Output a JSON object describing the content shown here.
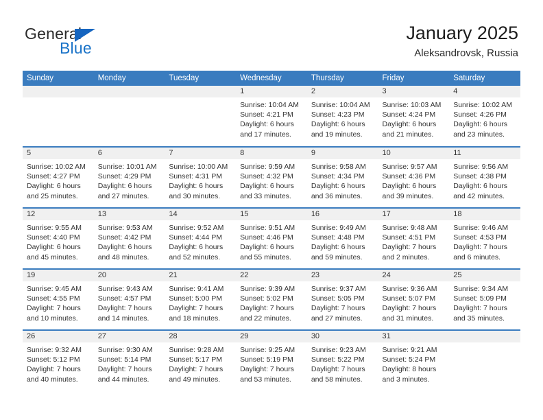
{
  "brand": {
    "name_top": "General",
    "name_bottom": "Blue",
    "triangle_color": "#1565c0",
    "blue_color": "#1a73c8"
  },
  "header": {
    "title": "January 2025",
    "location": "Aleksandrovsk, Russia"
  },
  "theme": {
    "header_blue": "#3a7cbf",
    "daynum_bg": "#f0f0f0",
    "text": "#333333"
  },
  "calendar": {
    "weekday_headers": [
      "Sunday",
      "Monday",
      "Tuesday",
      "Wednesday",
      "Thursday",
      "Friday",
      "Saturday"
    ],
    "weeks": [
      [
        {
          "day": "",
          "empty": true
        },
        {
          "day": "",
          "empty": true
        },
        {
          "day": "",
          "empty": true
        },
        {
          "day": "1",
          "sunrise": "Sunrise: 10:04 AM",
          "sunset": "Sunset: 4:21 PM",
          "daylight1": "Daylight: 6 hours",
          "daylight2": "and 17 minutes."
        },
        {
          "day": "2",
          "sunrise": "Sunrise: 10:04 AM",
          "sunset": "Sunset: 4:23 PM",
          "daylight1": "Daylight: 6 hours",
          "daylight2": "and 19 minutes."
        },
        {
          "day": "3",
          "sunrise": "Sunrise: 10:03 AM",
          "sunset": "Sunset: 4:24 PM",
          "daylight1": "Daylight: 6 hours",
          "daylight2": "and 21 minutes."
        },
        {
          "day": "4",
          "sunrise": "Sunrise: 10:02 AM",
          "sunset": "Sunset: 4:26 PM",
          "daylight1": "Daylight: 6 hours",
          "daylight2": "and 23 minutes."
        }
      ],
      [
        {
          "day": "5",
          "sunrise": "Sunrise: 10:02 AM",
          "sunset": "Sunset: 4:27 PM",
          "daylight1": "Daylight: 6 hours",
          "daylight2": "and 25 minutes."
        },
        {
          "day": "6",
          "sunrise": "Sunrise: 10:01 AM",
          "sunset": "Sunset: 4:29 PM",
          "daylight1": "Daylight: 6 hours",
          "daylight2": "and 27 minutes."
        },
        {
          "day": "7",
          "sunrise": "Sunrise: 10:00 AM",
          "sunset": "Sunset: 4:31 PM",
          "daylight1": "Daylight: 6 hours",
          "daylight2": "and 30 minutes."
        },
        {
          "day": "8",
          "sunrise": "Sunrise: 9:59 AM",
          "sunset": "Sunset: 4:32 PM",
          "daylight1": "Daylight: 6 hours",
          "daylight2": "and 33 minutes."
        },
        {
          "day": "9",
          "sunrise": "Sunrise: 9:58 AM",
          "sunset": "Sunset: 4:34 PM",
          "daylight1": "Daylight: 6 hours",
          "daylight2": "and 36 minutes."
        },
        {
          "day": "10",
          "sunrise": "Sunrise: 9:57 AM",
          "sunset": "Sunset: 4:36 PM",
          "daylight1": "Daylight: 6 hours",
          "daylight2": "and 39 minutes."
        },
        {
          "day": "11",
          "sunrise": "Sunrise: 9:56 AM",
          "sunset": "Sunset: 4:38 PM",
          "daylight1": "Daylight: 6 hours",
          "daylight2": "and 42 minutes."
        }
      ],
      [
        {
          "day": "12",
          "sunrise": "Sunrise: 9:55 AM",
          "sunset": "Sunset: 4:40 PM",
          "daylight1": "Daylight: 6 hours",
          "daylight2": "and 45 minutes."
        },
        {
          "day": "13",
          "sunrise": "Sunrise: 9:53 AM",
          "sunset": "Sunset: 4:42 PM",
          "daylight1": "Daylight: 6 hours",
          "daylight2": "and 48 minutes."
        },
        {
          "day": "14",
          "sunrise": "Sunrise: 9:52 AM",
          "sunset": "Sunset: 4:44 PM",
          "daylight1": "Daylight: 6 hours",
          "daylight2": "and 52 minutes."
        },
        {
          "day": "15",
          "sunrise": "Sunrise: 9:51 AM",
          "sunset": "Sunset: 4:46 PM",
          "daylight1": "Daylight: 6 hours",
          "daylight2": "and 55 minutes."
        },
        {
          "day": "16",
          "sunrise": "Sunrise: 9:49 AM",
          "sunset": "Sunset: 4:48 PM",
          "daylight1": "Daylight: 6 hours",
          "daylight2": "and 59 minutes."
        },
        {
          "day": "17",
          "sunrise": "Sunrise: 9:48 AM",
          "sunset": "Sunset: 4:51 PM",
          "daylight1": "Daylight: 7 hours",
          "daylight2": "and 2 minutes."
        },
        {
          "day": "18",
          "sunrise": "Sunrise: 9:46 AM",
          "sunset": "Sunset: 4:53 PM",
          "daylight1": "Daylight: 7 hours",
          "daylight2": "and 6 minutes."
        }
      ],
      [
        {
          "day": "19",
          "sunrise": "Sunrise: 9:45 AM",
          "sunset": "Sunset: 4:55 PM",
          "daylight1": "Daylight: 7 hours",
          "daylight2": "and 10 minutes."
        },
        {
          "day": "20",
          "sunrise": "Sunrise: 9:43 AM",
          "sunset": "Sunset: 4:57 PM",
          "daylight1": "Daylight: 7 hours",
          "daylight2": "and 14 minutes."
        },
        {
          "day": "21",
          "sunrise": "Sunrise: 9:41 AM",
          "sunset": "Sunset: 5:00 PM",
          "daylight1": "Daylight: 7 hours",
          "daylight2": "and 18 minutes."
        },
        {
          "day": "22",
          "sunrise": "Sunrise: 9:39 AM",
          "sunset": "Sunset: 5:02 PM",
          "daylight1": "Daylight: 7 hours",
          "daylight2": "and 22 minutes."
        },
        {
          "day": "23",
          "sunrise": "Sunrise: 9:37 AM",
          "sunset": "Sunset: 5:05 PM",
          "daylight1": "Daylight: 7 hours",
          "daylight2": "and 27 minutes."
        },
        {
          "day": "24",
          "sunrise": "Sunrise: 9:36 AM",
          "sunset": "Sunset: 5:07 PM",
          "daylight1": "Daylight: 7 hours",
          "daylight2": "and 31 minutes."
        },
        {
          "day": "25",
          "sunrise": "Sunrise: 9:34 AM",
          "sunset": "Sunset: 5:09 PM",
          "daylight1": "Daylight: 7 hours",
          "daylight2": "and 35 minutes."
        }
      ],
      [
        {
          "day": "26",
          "sunrise": "Sunrise: 9:32 AM",
          "sunset": "Sunset: 5:12 PM",
          "daylight1": "Daylight: 7 hours",
          "daylight2": "and 40 minutes."
        },
        {
          "day": "27",
          "sunrise": "Sunrise: 9:30 AM",
          "sunset": "Sunset: 5:14 PM",
          "daylight1": "Daylight: 7 hours",
          "daylight2": "and 44 minutes."
        },
        {
          "day": "28",
          "sunrise": "Sunrise: 9:28 AM",
          "sunset": "Sunset: 5:17 PM",
          "daylight1": "Daylight: 7 hours",
          "daylight2": "and 49 minutes."
        },
        {
          "day": "29",
          "sunrise": "Sunrise: 9:25 AM",
          "sunset": "Sunset: 5:19 PM",
          "daylight1": "Daylight: 7 hours",
          "daylight2": "and 53 minutes."
        },
        {
          "day": "30",
          "sunrise": "Sunrise: 9:23 AM",
          "sunset": "Sunset: 5:22 PM",
          "daylight1": "Daylight: 7 hours",
          "daylight2": "and 58 minutes."
        },
        {
          "day": "31",
          "sunrise": "Sunrise: 9:21 AM",
          "sunset": "Sunset: 5:24 PM",
          "daylight1": "Daylight: 8 hours",
          "daylight2": "and 3 minutes."
        },
        {
          "day": "",
          "empty": true
        }
      ]
    ]
  }
}
